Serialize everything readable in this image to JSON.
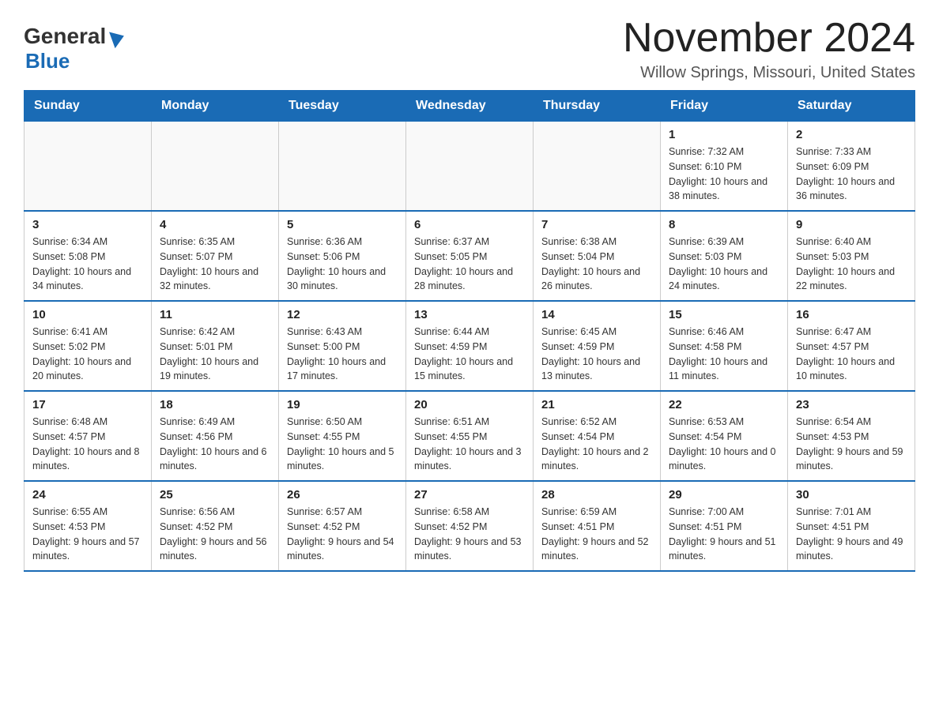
{
  "header": {
    "logo_general": "General",
    "logo_blue": "Blue",
    "month_title": "November 2024",
    "location": "Willow Springs, Missouri, United States"
  },
  "weekdays": [
    "Sunday",
    "Monday",
    "Tuesday",
    "Wednesday",
    "Thursday",
    "Friday",
    "Saturday"
  ],
  "weeks": [
    [
      {
        "day": "",
        "info": ""
      },
      {
        "day": "",
        "info": ""
      },
      {
        "day": "",
        "info": ""
      },
      {
        "day": "",
        "info": ""
      },
      {
        "day": "",
        "info": ""
      },
      {
        "day": "1",
        "info": "Sunrise: 7:32 AM\nSunset: 6:10 PM\nDaylight: 10 hours and 38 minutes."
      },
      {
        "day": "2",
        "info": "Sunrise: 7:33 AM\nSunset: 6:09 PM\nDaylight: 10 hours and 36 minutes."
      }
    ],
    [
      {
        "day": "3",
        "info": "Sunrise: 6:34 AM\nSunset: 5:08 PM\nDaylight: 10 hours and 34 minutes."
      },
      {
        "day": "4",
        "info": "Sunrise: 6:35 AM\nSunset: 5:07 PM\nDaylight: 10 hours and 32 minutes."
      },
      {
        "day": "5",
        "info": "Sunrise: 6:36 AM\nSunset: 5:06 PM\nDaylight: 10 hours and 30 minutes."
      },
      {
        "day": "6",
        "info": "Sunrise: 6:37 AM\nSunset: 5:05 PM\nDaylight: 10 hours and 28 minutes."
      },
      {
        "day": "7",
        "info": "Sunrise: 6:38 AM\nSunset: 5:04 PM\nDaylight: 10 hours and 26 minutes."
      },
      {
        "day": "8",
        "info": "Sunrise: 6:39 AM\nSunset: 5:03 PM\nDaylight: 10 hours and 24 minutes."
      },
      {
        "day": "9",
        "info": "Sunrise: 6:40 AM\nSunset: 5:03 PM\nDaylight: 10 hours and 22 minutes."
      }
    ],
    [
      {
        "day": "10",
        "info": "Sunrise: 6:41 AM\nSunset: 5:02 PM\nDaylight: 10 hours and 20 minutes."
      },
      {
        "day": "11",
        "info": "Sunrise: 6:42 AM\nSunset: 5:01 PM\nDaylight: 10 hours and 19 minutes."
      },
      {
        "day": "12",
        "info": "Sunrise: 6:43 AM\nSunset: 5:00 PM\nDaylight: 10 hours and 17 minutes."
      },
      {
        "day": "13",
        "info": "Sunrise: 6:44 AM\nSunset: 4:59 PM\nDaylight: 10 hours and 15 minutes."
      },
      {
        "day": "14",
        "info": "Sunrise: 6:45 AM\nSunset: 4:59 PM\nDaylight: 10 hours and 13 minutes."
      },
      {
        "day": "15",
        "info": "Sunrise: 6:46 AM\nSunset: 4:58 PM\nDaylight: 10 hours and 11 minutes."
      },
      {
        "day": "16",
        "info": "Sunrise: 6:47 AM\nSunset: 4:57 PM\nDaylight: 10 hours and 10 minutes."
      }
    ],
    [
      {
        "day": "17",
        "info": "Sunrise: 6:48 AM\nSunset: 4:57 PM\nDaylight: 10 hours and 8 minutes."
      },
      {
        "day": "18",
        "info": "Sunrise: 6:49 AM\nSunset: 4:56 PM\nDaylight: 10 hours and 6 minutes."
      },
      {
        "day": "19",
        "info": "Sunrise: 6:50 AM\nSunset: 4:55 PM\nDaylight: 10 hours and 5 minutes."
      },
      {
        "day": "20",
        "info": "Sunrise: 6:51 AM\nSunset: 4:55 PM\nDaylight: 10 hours and 3 minutes."
      },
      {
        "day": "21",
        "info": "Sunrise: 6:52 AM\nSunset: 4:54 PM\nDaylight: 10 hours and 2 minutes."
      },
      {
        "day": "22",
        "info": "Sunrise: 6:53 AM\nSunset: 4:54 PM\nDaylight: 10 hours and 0 minutes."
      },
      {
        "day": "23",
        "info": "Sunrise: 6:54 AM\nSunset: 4:53 PM\nDaylight: 9 hours and 59 minutes."
      }
    ],
    [
      {
        "day": "24",
        "info": "Sunrise: 6:55 AM\nSunset: 4:53 PM\nDaylight: 9 hours and 57 minutes."
      },
      {
        "day": "25",
        "info": "Sunrise: 6:56 AM\nSunset: 4:52 PM\nDaylight: 9 hours and 56 minutes."
      },
      {
        "day": "26",
        "info": "Sunrise: 6:57 AM\nSunset: 4:52 PM\nDaylight: 9 hours and 54 minutes."
      },
      {
        "day": "27",
        "info": "Sunrise: 6:58 AM\nSunset: 4:52 PM\nDaylight: 9 hours and 53 minutes."
      },
      {
        "day": "28",
        "info": "Sunrise: 6:59 AM\nSunset: 4:51 PM\nDaylight: 9 hours and 52 minutes."
      },
      {
        "day": "29",
        "info": "Sunrise: 7:00 AM\nSunset: 4:51 PM\nDaylight: 9 hours and 51 minutes."
      },
      {
        "day": "30",
        "info": "Sunrise: 7:01 AM\nSunset: 4:51 PM\nDaylight: 9 hours and 49 minutes."
      }
    ]
  ]
}
